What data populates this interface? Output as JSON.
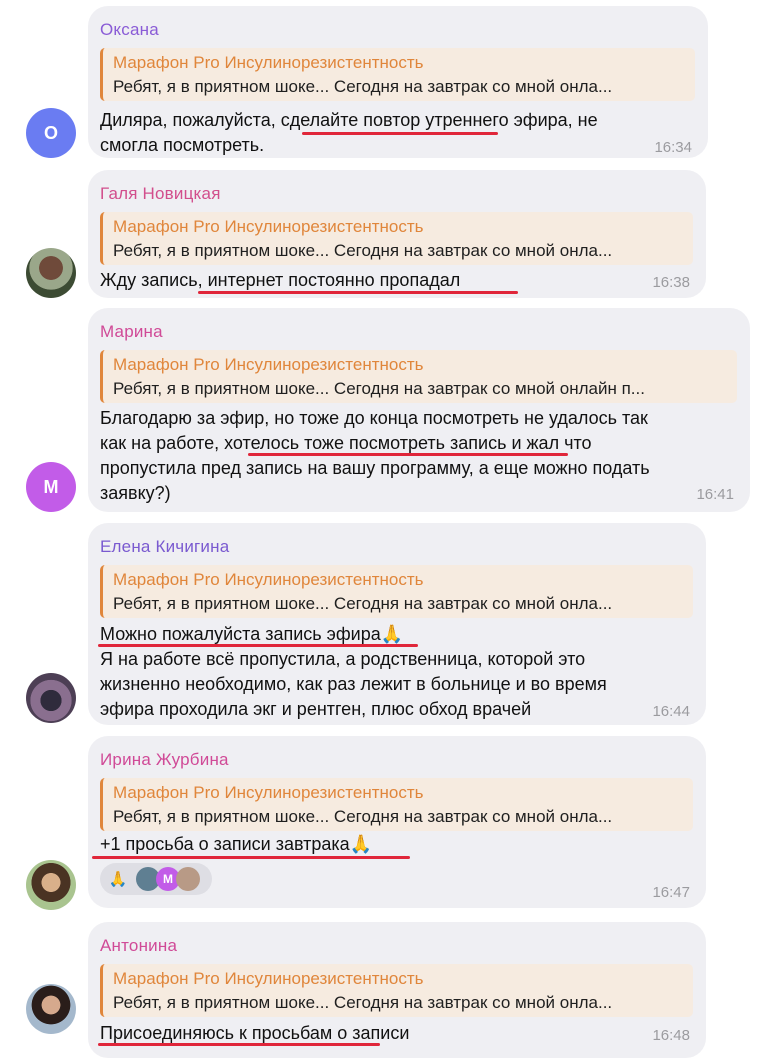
{
  "reply": {
    "title": "Марафон Pro Инсулинорезистентность",
    "text": "Ребят, я в приятном шоке...  Сегодня на завтрак со мной онла...",
    "text_wide": "Ребят, я в приятном шоке...  Сегодня на завтрак со мной онлайн п..."
  },
  "messages": [
    {
      "sender": "Оксана",
      "sender_color": "#8a5cd6",
      "avatar_letter": "О",
      "avatar_color": "#6a7cf2",
      "lines": [
        "Диляра, пожалуйста, сделайте повтор утреннего эфира, не",
        "смогла посмотреть."
      ],
      "time": "16:34"
    },
    {
      "sender": "Галя Новицкая",
      "sender_color": "#d24e8c",
      "avatar_icon": "photo-avatar",
      "lines": [
        "Жду запись, интернет постоянно пропадал"
      ],
      "time": "16:38"
    },
    {
      "sender": "Марина",
      "sender_color": "#d04a97",
      "avatar_letter": "М",
      "avatar_color": "#c25ce8",
      "lines": [
        "Благодарю за эфир, но тоже до конца посмотреть не удалось так",
        "как на работе, хотелось тоже посмотреть запись и жал что",
        "пропустила пред запись на вашу программу, а еще можно подать",
        "заявку?)"
      ],
      "time": "16:41"
    },
    {
      "sender": "Елена Кичигина",
      "sender_color": "#7a5ad0",
      "avatar_icon": "photo-avatar",
      "lines": [
        "Можно пожалуйста запись эфира🙏",
        "Я на работе всё пропустила, а родственница, которой это",
        "жизненно необходимо, как раз лежит в больнице и во время",
        "эфира проходила экг и рентген, плюс обход врачей"
      ],
      "time": "16:44"
    },
    {
      "sender": "Ирина Журбина",
      "sender_color": "#d04a97",
      "avatar_icon": "photo-avatar",
      "lines": [
        "+1 просьба о записи завтрака🙏"
      ],
      "time": "16:47",
      "reactions": {
        "emoji": "🙏",
        "badge_letter": "М"
      }
    },
    {
      "sender": "Антонина",
      "sender_color": "#d04a97",
      "avatar_icon": "photo-avatar",
      "lines": [
        "Присоединяюсь к просьбам о записи"
      ],
      "time": "16:48"
    }
  ],
  "colors": {
    "underline": "#e0263a",
    "reply_accent": "#e0863b",
    "bubble": "#efeff3"
  }
}
